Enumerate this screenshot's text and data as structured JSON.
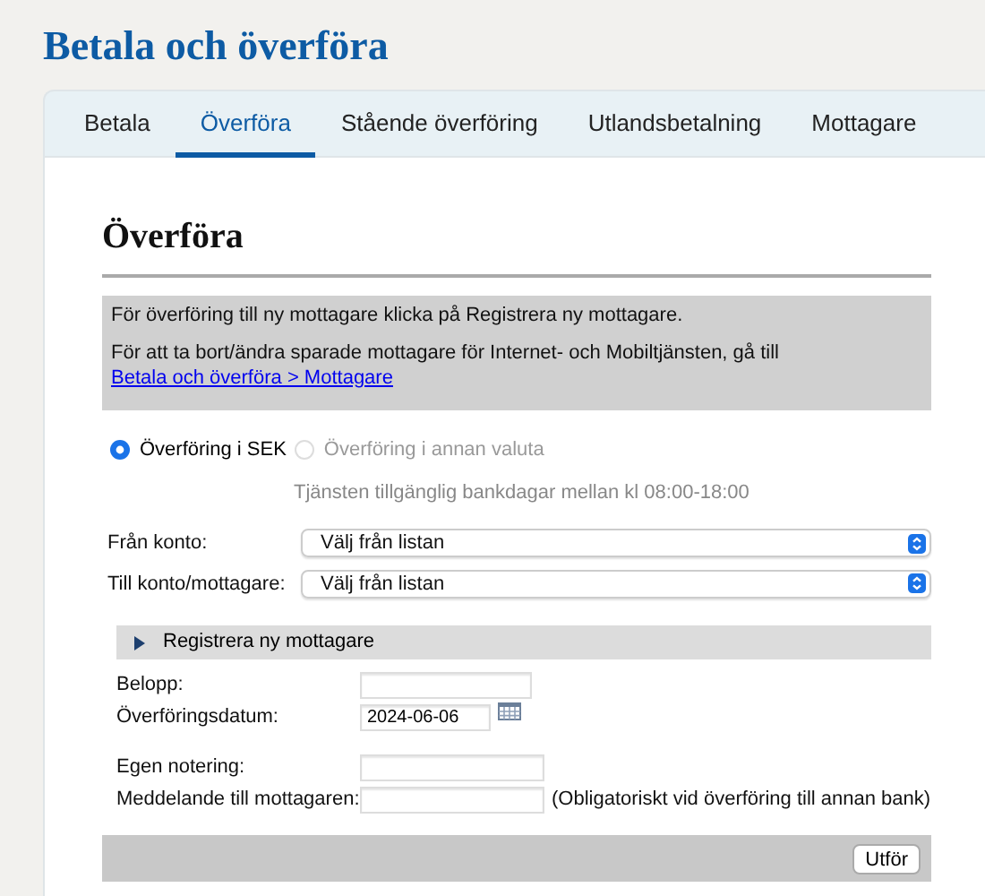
{
  "title": "Betala och överföra",
  "tabs": [
    {
      "label": "Betala",
      "selected": false
    },
    {
      "label": "Överföra",
      "selected": true
    },
    {
      "label": "Stående överföring",
      "selected": false
    },
    {
      "label": "Utlandsbetalning",
      "selected": false
    },
    {
      "label": "Mottagare",
      "selected": false
    }
  ],
  "heading": "Överföra",
  "info": {
    "line1": "För överföring till ny mottagare klicka på Registrera ny mottagare.",
    "line2": "För att ta bort/ändra sparade mottagare för Internet- och Mobiltjänsten, gå till",
    "link": "Betala och överföra > Mottagare"
  },
  "radios": [
    {
      "label": "Överföring i SEK",
      "selected": true,
      "disabled": false
    },
    {
      "label": "Överföring i annan valuta",
      "selected": false,
      "disabled": true
    }
  ],
  "radio_note": "Tjänsten tillgänglig bankdagar mellan kl 08:00-18:00",
  "selects": [
    {
      "label": "Från konto:",
      "value": "Välj från listan"
    },
    {
      "label": "Till konto/mottagare:",
      "value": "Välj från listan"
    }
  ],
  "register": {
    "label": "Registrera ny mottagare",
    "expanded": false
  },
  "fields": [
    {
      "kind": "text",
      "label": "Belopp:"
    },
    {
      "kind": "date",
      "label": "Överföringsdatum:",
      "value": "2024-06-06"
    },
    {
      "kind": "gap"
    },
    {
      "kind": "text",
      "label": "Egen notering:"
    },
    {
      "kind": "text",
      "label": "Meddelande till mottagaren:",
      "note": "(Obligatoriskt vid överföring till annan bank)"
    }
  ],
  "submit": "Utför"
}
